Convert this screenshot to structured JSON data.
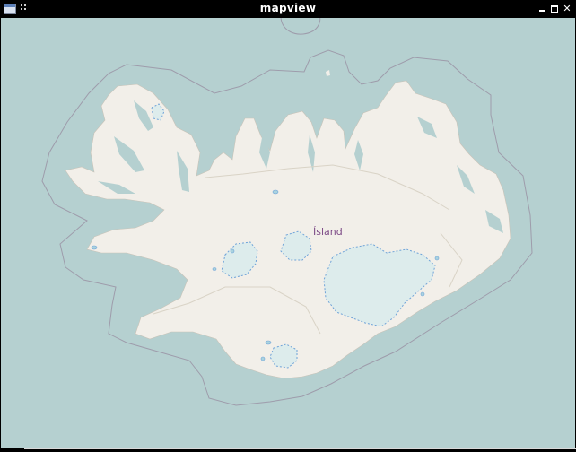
{
  "window": {
    "title": "mapview",
    "app_icon": "window-app-icon",
    "buttons": {
      "minimize": "minimize-icon",
      "maximize": "maximize-icon",
      "close": "✕"
    }
  },
  "map": {
    "place_label": "Ísland",
    "colors": {
      "water": "#b5d0d0",
      "land": "#f2efe9",
      "glacier": "#ddecec",
      "border": "#9e9cab",
      "label": "#7d4b87",
      "lake": "#aad3df"
    }
  }
}
